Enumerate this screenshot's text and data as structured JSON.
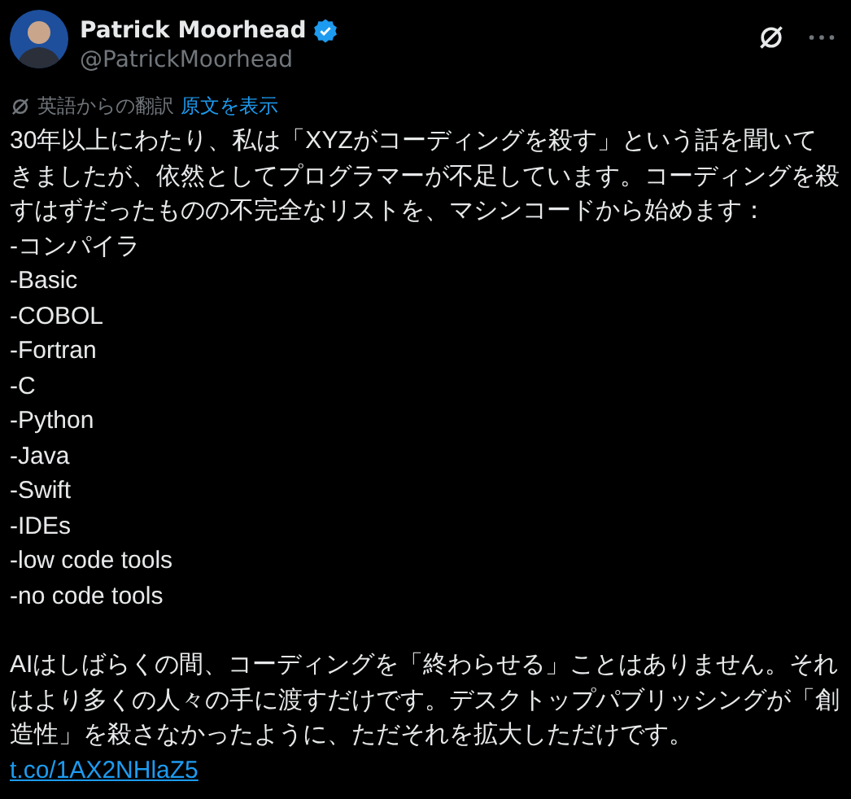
{
  "author": {
    "name": "Patrick Moorhead",
    "verified": true,
    "handle": "@PatrickMoorhead"
  },
  "translation": {
    "label": "英語からの翻訳",
    "link": "原文を表示"
  },
  "intro": "30年以上にわたり、私は「XYZがコーディングを殺す」という話を聞いてきましたが、依然としてプログラマーが不足しています。コーディングを殺すはずだったものの不完全なリストを、マシンコードから始めます：",
  "list_items": [
    "-コンパイラ",
    "-Basic",
    "-COBOL",
    "-Fortran",
    "-C",
    "-Python",
    "-Java",
    "-Swift",
    "-IDEs",
    "-low code tools",
    "-no code tools"
  ],
  "closing": "AIはしばらくの間、コーディングを「終わらせる」ことはありません。それはより多くの人々の手に渡すだけです。デスクトップパブリッシングが「創造性」を殺さなかったように、ただそれを拡大しただけです。",
  "link": "t.co/1AX2NHlaZ5"
}
